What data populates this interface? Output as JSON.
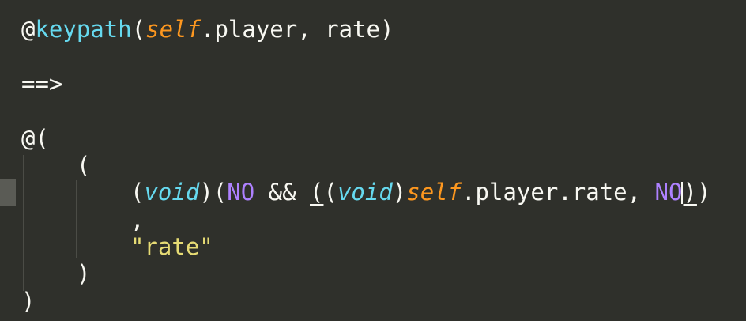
{
  "code": {
    "line1": {
      "at": "@",
      "keyword": "keypath",
      "open_paren": "(",
      "self": "self",
      "rest": ".player, rate)"
    },
    "line2": {
      "arrow": "==>"
    },
    "line3": {
      "text": "@("
    },
    "line4": {
      "text": "("
    },
    "line5": {
      "open": "(",
      "void1": "void",
      "mid1": ")(",
      "no1": "NO",
      "mid2": " && ",
      "paren_u": "(",
      "paren2": "(",
      "void2": "void",
      "mid3": ")",
      "self": "self",
      "mid4": ".player.rate, ",
      "no2_a": "N",
      "no2_b": "O",
      "close_u": ")",
      "close2": ")"
    },
    "line6": {
      "text": ","
    },
    "line7": {
      "string": "\"rate\""
    },
    "line8": {
      "text": ")"
    },
    "line9": {
      "text": ")"
    }
  },
  "colors": {
    "background": "#2f302b",
    "keyword": "#66d9ef",
    "self": "#fd971f",
    "constant": "#ae81ff",
    "string": "#e6db74",
    "text": "#f8f8f2"
  }
}
